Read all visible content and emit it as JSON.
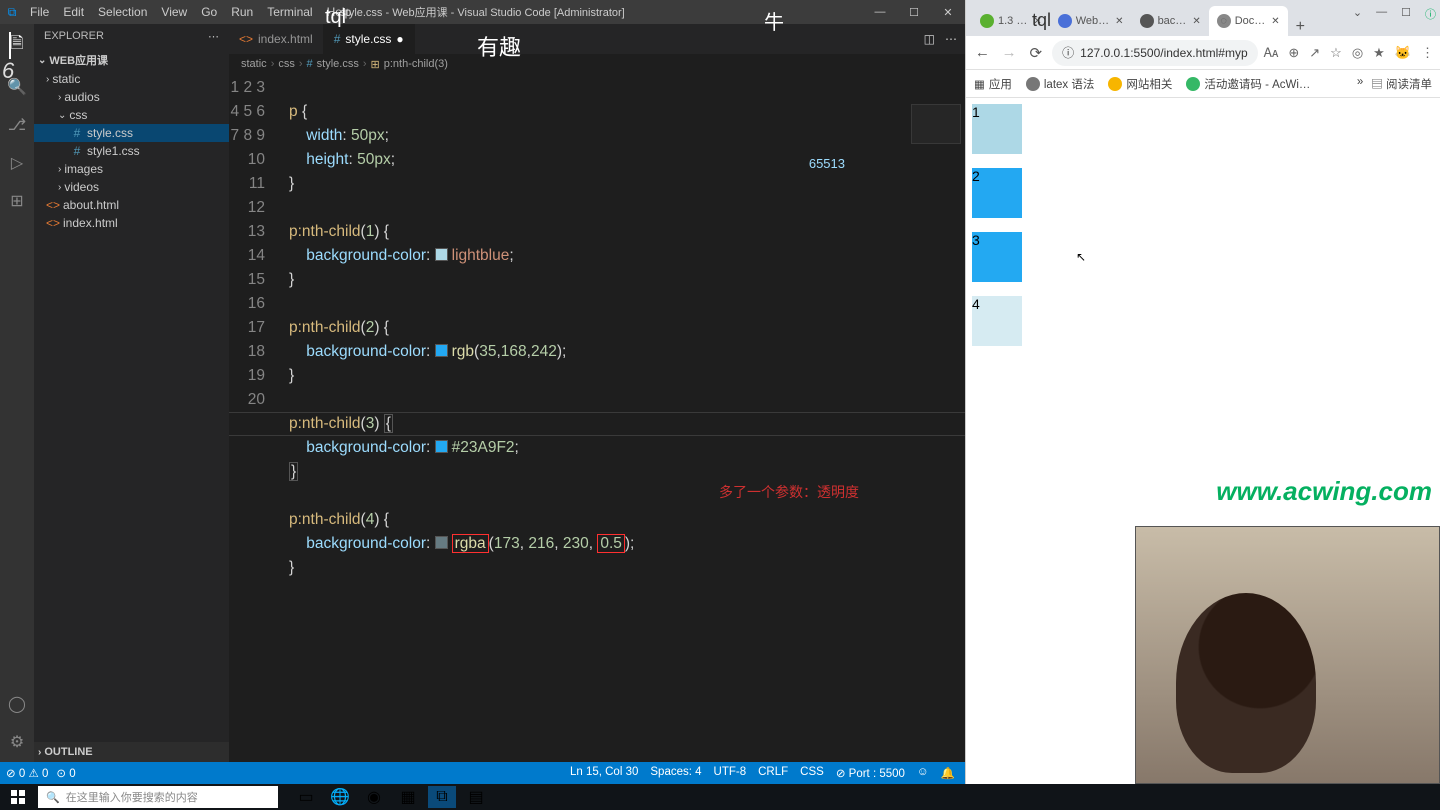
{
  "vscode": {
    "title": "style.css - Web应用课 - Visual Studio Code [Administrator]",
    "menu": [
      "File",
      "Edit",
      "Selection",
      "View",
      "Go",
      "Run",
      "Terminal",
      "Help"
    ],
    "explorer_header": "EXPLORER",
    "project_name": "WEB应用课",
    "tree": [
      {
        "label": "static",
        "indent": 12,
        "chev": "›",
        "icon": "",
        "type": "folder"
      },
      {
        "label": "audios",
        "indent": 24,
        "chev": "›",
        "icon": "",
        "type": "folder"
      },
      {
        "label": "css",
        "indent": 24,
        "chev": "⌄",
        "icon": "",
        "type": "folder"
      },
      {
        "label": "style.css",
        "indent": 36,
        "chev": "",
        "icon": "#",
        "type": "css",
        "selected": true
      },
      {
        "label": "style1.css",
        "indent": 36,
        "chev": "",
        "icon": "#",
        "type": "css"
      },
      {
        "label": "images",
        "indent": 24,
        "chev": "›",
        "icon": "",
        "type": "folder"
      },
      {
        "label": "videos",
        "indent": 24,
        "chev": "›",
        "icon": "",
        "type": "folder"
      },
      {
        "label": "about.html",
        "indent": 12,
        "chev": "",
        "icon": "<>",
        "type": "html"
      },
      {
        "label": "index.html",
        "indent": 12,
        "chev": "",
        "icon": "<>",
        "type": "html"
      }
    ],
    "outline": "OUTLINE",
    "tabs": [
      {
        "label": "index.html",
        "icon": "<>",
        "iconColor": "#e37933",
        "active": false
      },
      {
        "label": "style.css",
        "icon": "#",
        "iconColor": "#519aba",
        "active": true,
        "modified": true
      }
    ],
    "breadcrumb": [
      "static",
      "css",
      "style.css",
      "p:nth-child(3)"
    ],
    "random_number": "65513",
    "annotation": "多了一个参数：透明度",
    "code_lines": 20,
    "statusbar": {
      "errors": "0",
      "warnings": "0",
      "port_zero": "0",
      "lncol": "Ln 15, Col 30",
      "spaces": "Spaces: 4",
      "encoding": "UTF-8",
      "eol": "CRLF",
      "lang": "CSS",
      "port": "Port : 5500"
    }
  },
  "chrome": {
    "tabs": [
      {
        "label": "1.3 …",
        "favicon": "#5ab030"
      },
      {
        "label": "Web…",
        "favicon": "#4a70d8"
      },
      {
        "label": "bac…",
        "favicon": "#555"
      },
      {
        "label": "Doc…",
        "favicon": "#888",
        "active": true
      }
    ],
    "url": "127.0.0.1:5500/index.html#myp",
    "bookmarks": [
      {
        "label": "应用",
        "favicon": "#888",
        "apps": true
      },
      {
        "label": "latex 语法",
        "favicon": "#777"
      },
      {
        "label": "网站相关",
        "favicon": "#f7b500"
      },
      {
        "label": "活动邀请码 - AcWi…",
        "favicon": "#35b866"
      }
    ],
    "reader": "阅读清单",
    "colors": {
      "p1": "lightblue",
      "p2": "rgb(35,168,242)",
      "p3": "#23A9F2",
      "p4": "rgba(173,216,230,0.5)"
    }
  },
  "overlays": {
    "tql": "tql",
    "niu": "牛",
    "youqu": "有趣",
    "tql2": "tql",
    "watermark": "www.acwing.com",
    "num": "6"
  },
  "taskbar": {
    "search_placeholder": "在这里输入你要搜索的内容"
  }
}
